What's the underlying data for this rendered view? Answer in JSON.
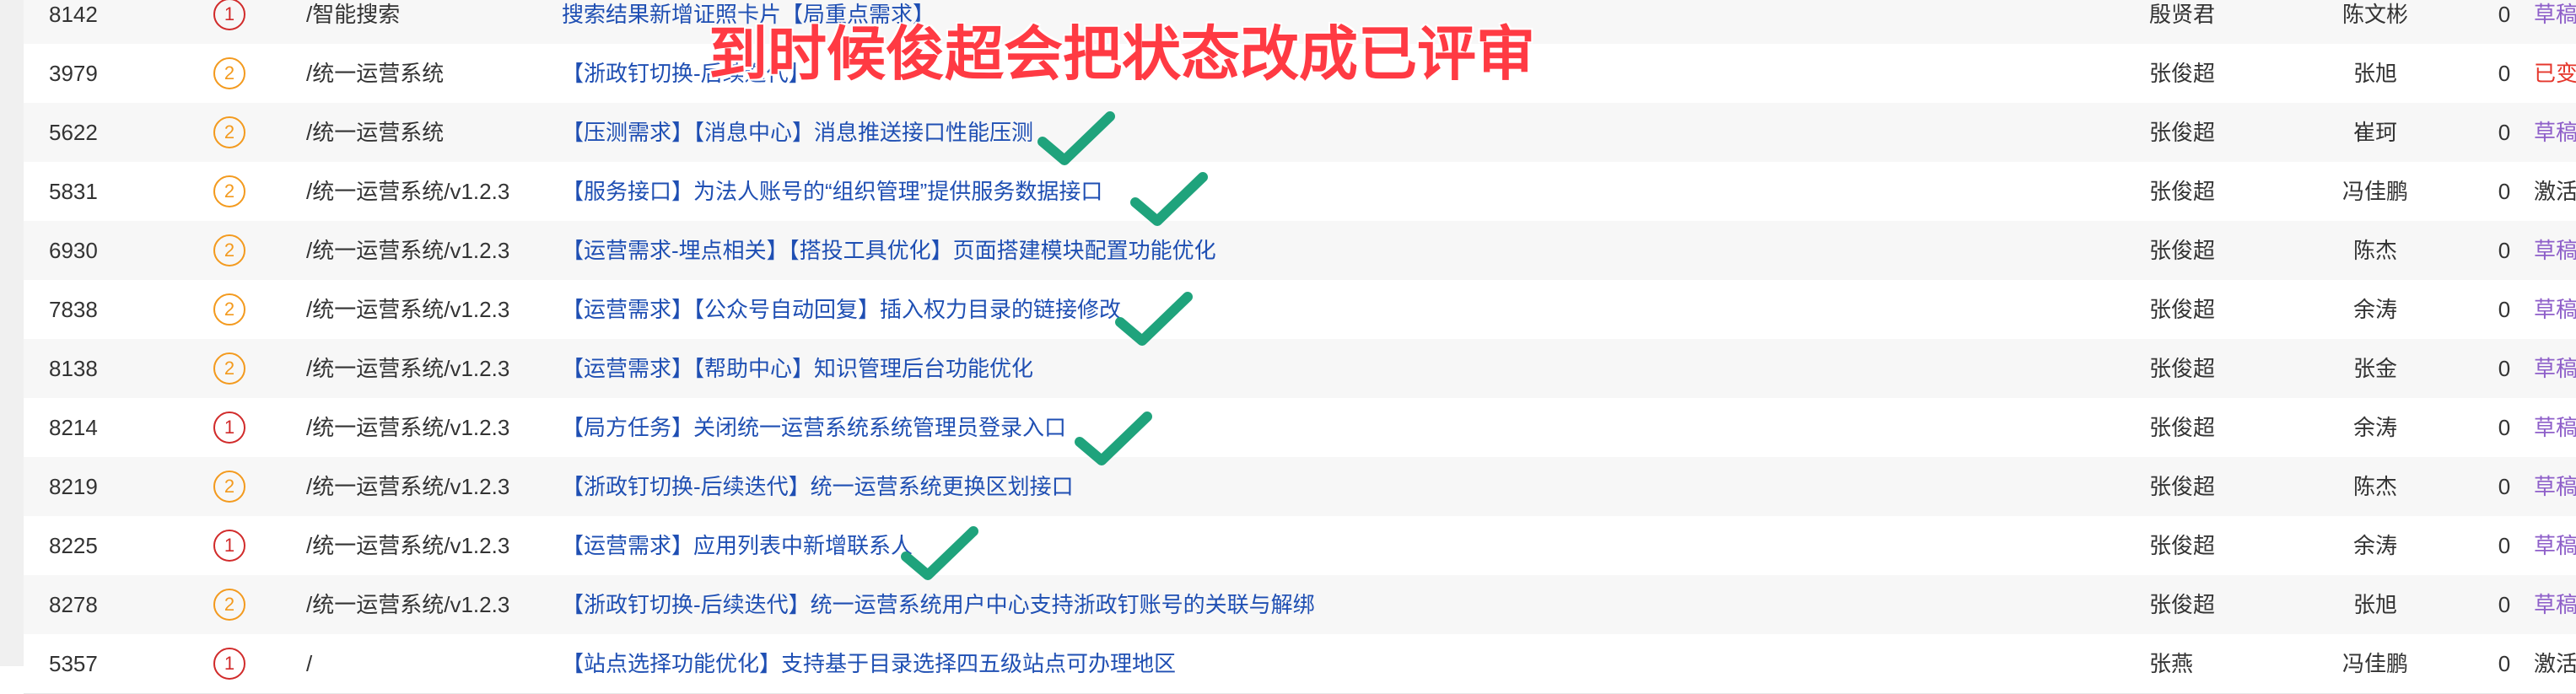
{
  "annotation": {
    "text": "到时候俊超会把状态改成已评审",
    "color": "#ff3a43"
  },
  "colors": {
    "title_link": "#1f4fb3",
    "priority_1": "#d12b2b",
    "priority_2": "#f39a1e",
    "status_draft": "#8e5fc9",
    "status_changed": "#e5372c",
    "check_mark": "#1fa37c"
  },
  "rows": [
    {
      "id": "8142",
      "priority": "1",
      "path": "/智能搜索",
      "title": "搜索结果新增证照卡片【局重点需求】",
      "creator": "殷贤君",
      "owner": "陈文彬",
      "count": "0",
      "status": "草稿",
      "status_type": "draft",
      "checked": false
    },
    {
      "id": "3979",
      "priority": "2",
      "path": "/统一运营系统",
      "title": "【浙政钉切换-后续迭代】",
      "creator": "张俊超",
      "owner": "张旭",
      "count": "0",
      "status": "已变更",
      "status_type": "changed",
      "checked": false
    },
    {
      "id": "5622",
      "priority": "2",
      "path": "/统一运营系统",
      "title": "【压测需求】【消息中心】消息推送接口性能压测",
      "creator": "张俊超",
      "owner": "崔珂",
      "count": "0",
      "status": "草稿",
      "status_type": "draft",
      "checked": true
    },
    {
      "id": "5831",
      "priority": "2",
      "path": "/统一运营系统/v1.2.3",
      "title": "【服务接口】为法人账号的“组织管理”提供服务数据接口",
      "creator": "张俊超",
      "owner": "冯佳鹏",
      "count": "0",
      "status": "激活",
      "status_type": "active",
      "checked": true
    },
    {
      "id": "6930",
      "priority": "2",
      "path": "/统一运营系统/v1.2.3",
      "title": "【运营需求-埋点相关】【搭投工具优化】页面搭建模块配置功能优化",
      "creator": "张俊超",
      "owner": "陈杰",
      "count": "0",
      "status": "草稿",
      "status_type": "draft",
      "checked": false
    },
    {
      "id": "7838",
      "priority": "2",
      "path": "/统一运营系统/v1.2.3",
      "title": "【运营需求】【公众号自动回复】插入权力目录的链接修改",
      "creator": "张俊超",
      "owner": "余涛",
      "count": "0",
      "status": "草稿",
      "status_type": "draft",
      "checked": true
    },
    {
      "id": "8138",
      "priority": "2",
      "path": "/统一运营系统/v1.2.3",
      "title": "【运营需求】【帮助中心】知识管理后台功能优化",
      "creator": "张俊超",
      "owner": "张金",
      "count": "0",
      "status": "草稿",
      "status_type": "draft",
      "checked": false
    },
    {
      "id": "8214",
      "priority": "1",
      "path": "/统一运营系统/v1.2.3",
      "title": "【局方任务】关闭统一运营系统系统管理员登录入口",
      "creator": "张俊超",
      "owner": "余涛",
      "count": "0",
      "status": "草稿",
      "status_type": "draft",
      "checked": true
    },
    {
      "id": "8219",
      "priority": "2",
      "path": "/统一运营系统/v1.2.3",
      "title": "【浙政钉切换-后续迭代】统一运营系统更换区划接口",
      "creator": "张俊超",
      "owner": "陈杰",
      "count": "0",
      "status": "草稿",
      "status_type": "draft",
      "checked": false
    },
    {
      "id": "8225",
      "priority": "1",
      "path": "/统一运营系统/v1.2.3",
      "title": "【运营需求】应用列表中新增联系人",
      "creator": "张俊超",
      "owner": "余涛",
      "count": "0",
      "status": "草稿",
      "status_type": "draft",
      "checked": true
    },
    {
      "id": "8278",
      "priority": "2",
      "path": "/统一运营系统/v1.2.3",
      "title": "【浙政钉切换-后续迭代】统一运营系统用户中心支持浙政钉账号的关联与解绑",
      "creator": "张俊超",
      "owner": "张旭",
      "count": "0",
      "status": "草稿",
      "status_type": "draft",
      "checked": false
    },
    {
      "id": "5357",
      "priority": "1",
      "path": "/",
      "title": "【站点选择功能优化】支持基于目录选择四五级站点可办理地区",
      "creator": "张燕",
      "owner": "冯佳鹏",
      "count": "0",
      "status": "激活",
      "status_type": "active",
      "checked": false
    }
  ]
}
